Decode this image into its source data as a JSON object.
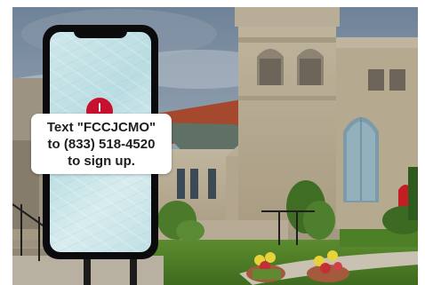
{
  "caption": {
    "line1": "Text \"FCCJCMO\"",
    "line2": "to (833) 518-4520",
    "line3": "to sign up."
  },
  "icons": {
    "phone": "smartphone-icon",
    "notification": "notification-dot-icon"
  },
  "colors": {
    "sky": "#7f93a6",
    "stone": "#b7ab95",
    "door": "#c21e24",
    "phone_frame": "#0b0b0d",
    "caption_bg": "#ffffff",
    "caption_text": "#1e1e1e",
    "notification": "#c8102e"
  }
}
